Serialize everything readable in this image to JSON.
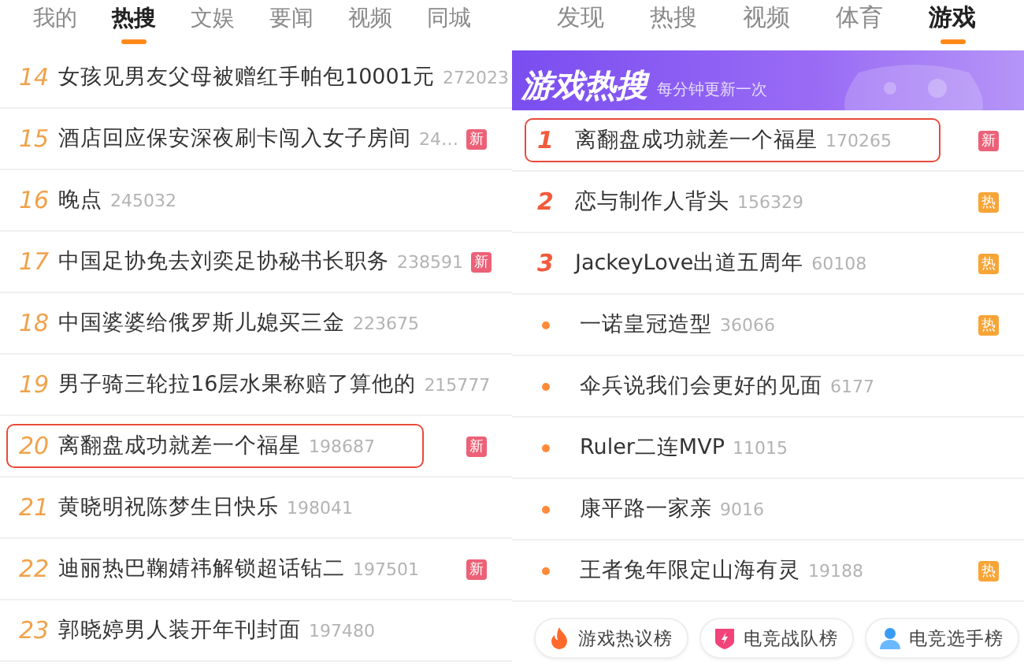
{
  "left": {
    "tabs": [
      {
        "label": "我的",
        "selected": false
      },
      {
        "label": "热搜",
        "selected": true
      },
      {
        "label": "文娱",
        "selected": false
      },
      {
        "label": "要闻",
        "selected": false
      },
      {
        "label": "视频",
        "selected": false
      },
      {
        "label": "同城",
        "selected": false
      }
    ],
    "rows": [
      {
        "kind": "numbered",
        "rank": "14",
        "title": "女孩见男友父母被赠红手帕包10001元",
        "count": "272023",
        "highlighted": false
      },
      {
        "kind": "numbered",
        "rank": "15",
        "title": "酒店回应保安深夜刷卡闯入女子房间",
        "count": "24…",
        "badge": {
          "kind": "new",
          "text": "新"
        },
        "highlighted": false
      },
      {
        "kind": "numbered",
        "rank": "16",
        "title": "晚点",
        "count": "245032",
        "highlighted": false
      },
      {
        "kind": "numbered",
        "rank": "17",
        "title": "中国足协免去刘奕足协秘书长职务",
        "count": "238591",
        "badge": {
          "kind": "new",
          "text": "新"
        },
        "highlighted": false
      },
      {
        "kind": "numbered",
        "rank": "18",
        "title": "中国婆婆给俄罗斯儿媳买三金",
        "count": "223675",
        "highlighted": false
      },
      {
        "kind": "numbered",
        "rank": "19",
        "title": "男子骑三轮拉16层水果称赔了算他的",
        "count": "215777",
        "highlighted": false
      },
      {
        "kind": "numbered",
        "rank": "20",
        "title": "离翻盘成功就差一个福星",
        "count": "198687",
        "badge": {
          "kind": "new",
          "text": "新"
        },
        "highlighted": true
      },
      {
        "kind": "numbered",
        "rank": "21",
        "title": "黄晓明祝陈梦生日快乐",
        "count": "198041",
        "highlighted": false
      },
      {
        "kind": "numbered",
        "rank": "22",
        "title": "迪丽热巴鞠婧祎解锁超话钻二",
        "count": "197501",
        "badge": {
          "kind": "new",
          "text": "新"
        },
        "highlighted": false
      },
      {
        "kind": "numbered",
        "rank": "23",
        "title": "郭晓婷男人装开年刊封面",
        "count": "197480",
        "highlighted": false
      }
    ]
  },
  "right": {
    "tabs": [
      {
        "label": "发现",
        "selected": false
      },
      {
        "label": "热搜",
        "selected": false
      },
      {
        "label": "视频",
        "selected": false
      },
      {
        "label": "体育",
        "selected": false
      },
      {
        "label": "游戏",
        "selected": true
      }
    ],
    "banner": {
      "title": "游戏热搜",
      "subtitle": "每分钟更新一次"
    },
    "rows": [
      {
        "kind": "numbered",
        "rank": "1",
        "title": "离翻盘成功就差一个福星",
        "count": "170265",
        "badge": {
          "kind": "new",
          "text": "新"
        },
        "highlighted": true
      },
      {
        "kind": "numbered",
        "rank": "2",
        "title": "恋与制作人背头",
        "count": "156329",
        "badge": {
          "kind": "hot",
          "text": "热"
        },
        "highlighted": false
      },
      {
        "kind": "numbered",
        "rank": "3",
        "title": "JackeyLove出道五周年",
        "count": "60108",
        "badge": {
          "kind": "hot",
          "text": "热"
        },
        "highlighted": false
      },
      {
        "kind": "dot",
        "title": "一诺皇冠造型",
        "count": "36066",
        "badge": {
          "kind": "hot",
          "text": "热"
        },
        "highlighted": false
      },
      {
        "kind": "dot",
        "title": "伞兵说我们会更好的见面",
        "count": "6177",
        "highlighted": false
      },
      {
        "kind": "dot",
        "title": "Ruler二连MVP",
        "count": "11015",
        "highlighted": false
      },
      {
        "kind": "dot",
        "title": "康平路一家亲",
        "count": "9016",
        "highlighted": false
      },
      {
        "kind": "dot",
        "title": "王者兔年限定山海有灵",
        "count": "19188",
        "badge": {
          "kind": "hot",
          "text": "热"
        },
        "highlighted": false
      }
    ],
    "links": [
      {
        "kind": "flame",
        "label": "游戏热议榜"
      },
      {
        "kind": "shield",
        "label": "电竞战队榜"
      },
      {
        "kind": "person",
        "label": "电竞选手榜"
      }
    ]
  }
}
